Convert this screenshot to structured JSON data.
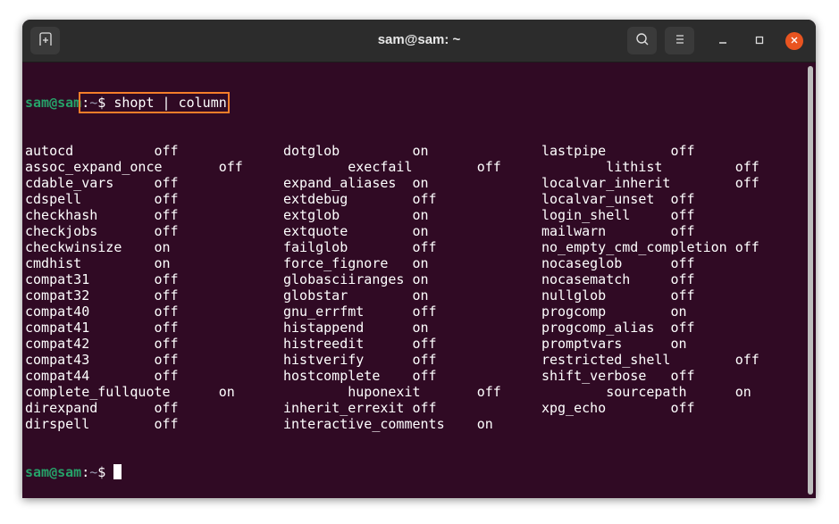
{
  "window": {
    "title": "sam@sam: ~"
  },
  "titlebar": {
    "new_tab_icon": "new-tab-icon",
    "search_icon": "search-icon",
    "menu_icon": "hamburger-menu-icon",
    "minimize_icon": "minimize-icon",
    "maximize_icon": "maximize-icon",
    "close_icon": "close-icon"
  },
  "colors": {
    "background": "#300a24",
    "prompt_user": "#26a269",
    "highlight": "#f57e2a",
    "close": "#e95420"
  },
  "prompt": {
    "user_host": "sam@sam",
    "colon": ":",
    "path": "~",
    "symbol": "$ "
  },
  "command": "shopt | column",
  "output": [
    "autocd          off             dotglob         on              lastpipe        off",
    "assoc_expand_once       off             execfail        off             lithist         off",
    "cdable_vars     off             expand_aliases  on              localvar_inherit        off",
    "cdspell         off             extdebug        off             localvar_unset  off",
    "checkhash       off             extglob         on              login_shell     off",
    "checkjobs       off             extquote        on              mailwarn        off",
    "checkwinsize    on              failglob        off             no_empty_cmd_completion off",
    "cmdhist         on              force_fignore   on              nocaseglob      off",
    "compat31        off             globasciiranges on              nocasematch     off",
    "compat32        off             globstar        on              nullglob        off",
    "compat40        off             gnu_errfmt      off             progcomp        on",
    "compat41        off             histappend      on              progcomp_alias  off",
    "compat42        off             histreedit      off             promptvars      on",
    "compat43        off             histverify      off             restricted_shell        off",
    "compat44        off             hostcomplete    off             shift_verbose   off",
    "complete_fullquote      on              huponexit       off             sourcepath      on",
    "direxpand       off             inherit_errexit off             xpg_echo        off",
    "dirspell        off             interactive_comments    on"
  ]
}
